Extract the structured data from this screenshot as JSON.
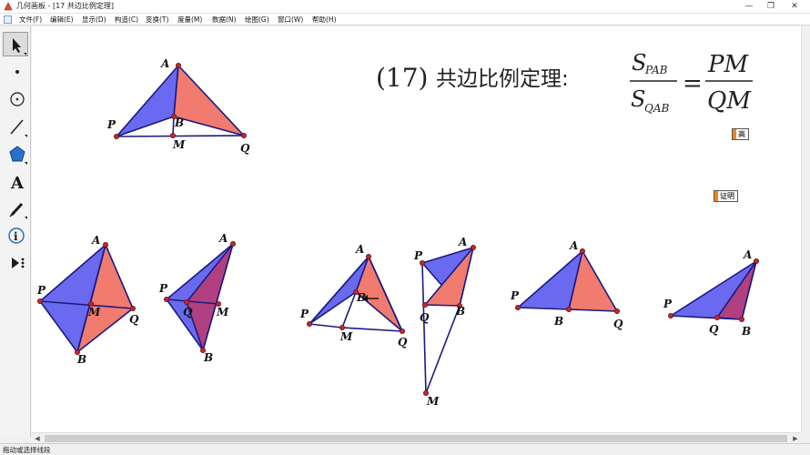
{
  "window": {
    "title": "几何画板 - [17 共边比例定理]",
    "controls": {
      "minimize": "—",
      "restore": "❐",
      "close": "✕"
    }
  },
  "menu": {
    "items": [
      "文件(F)",
      "编辑(E)",
      "显示(D)",
      "构造(C)",
      "变换(T)",
      "度量(M)",
      "数据(N)",
      "绘图(G)",
      "窗口(W)",
      "帮助(H)"
    ]
  },
  "toolbox": {
    "tools": [
      {
        "name": "arrow-select-icon",
        "active": true
      },
      {
        "name": "point-tool-icon"
      },
      {
        "name": "compass-tool-icon"
      },
      {
        "name": "line-tool-icon"
      },
      {
        "name": "polygon-tool-icon"
      },
      {
        "name": "text-tool-icon",
        "glyph": "A"
      },
      {
        "name": "marker-tool-icon"
      },
      {
        "name": "information-tool-icon",
        "glyph": "i"
      },
      {
        "name": "custom-tool-icon"
      }
    ]
  },
  "formula": {
    "number": "(17)",
    "name": "共边比例定理:",
    "s": "S",
    "sub_top": "PAB",
    "sub_bottom": "QAB",
    "equals": "=",
    "rhs_top": "PM",
    "rhs_bottom": "QM"
  },
  "buttons": {
    "height_label": "高",
    "proof_label": "证明"
  },
  "labels": {
    "A": "A",
    "B": "B",
    "P": "P",
    "Q": "Q",
    "M": "M"
  },
  "colors": {
    "blue_fill": "#6a6af0",
    "red_fill": "#f07b6e",
    "purple_fill": "#b0407f",
    "edge": "#1a1a80",
    "point": "#c0282e"
  },
  "status": {
    "text": "拖动或选择线段"
  },
  "scroll": {
    "left_arrow": "◀",
    "right_arrow": "▶"
  }
}
